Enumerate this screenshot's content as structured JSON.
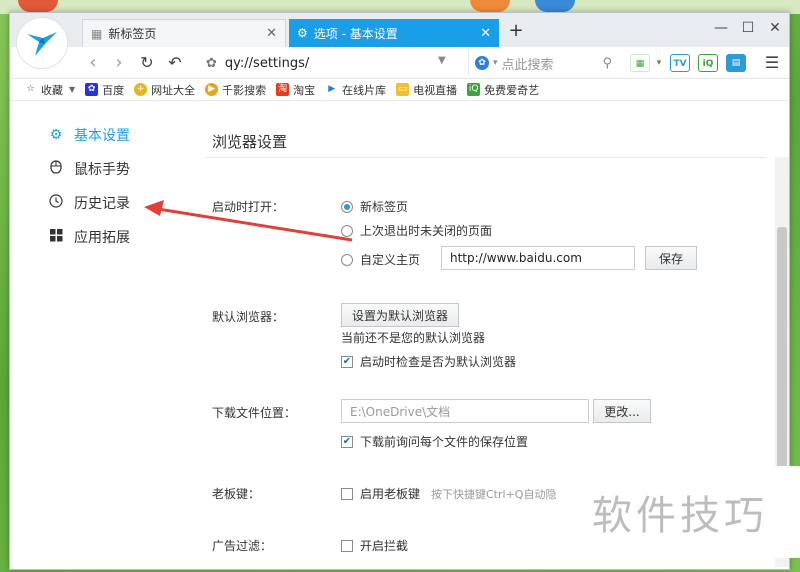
{
  "tabs": [
    {
      "label": "新标签页",
      "close": "✕"
    },
    {
      "label": "选项 - 基本设置",
      "close": "✕"
    }
  ],
  "new_tab_symbol": "+",
  "window_controls": {
    "minimize": "—",
    "maximize": "☐",
    "close": "✕"
  },
  "nav": {
    "back": "‹",
    "forward": "›",
    "refresh": "↻",
    "undo": "↶",
    "address": "qy://settings/",
    "search_placeholder": "点此搜索"
  },
  "bookmarks": [
    {
      "label": "收藏",
      "icon": "star-icon"
    },
    {
      "label": "百度",
      "icon": "baidu-icon"
    },
    {
      "label": "网址大全",
      "icon": "directory-icon"
    },
    {
      "label": "千影搜索",
      "icon": "video-search-icon"
    },
    {
      "label": "淘宝",
      "icon": "taobao-icon"
    },
    {
      "label": "在线片库",
      "icon": "film-library-icon"
    },
    {
      "label": "电视直播",
      "icon": "tv-live-icon"
    },
    {
      "label": "免费爱奇艺",
      "icon": "iqiyi-icon"
    }
  ],
  "sidebar": {
    "items": [
      {
        "label": "基本设置",
        "icon": "gear-icon",
        "active": true
      },
      {
        "label": "鼠标手势",
        "icon": "mouse-icon",
        "active": false
      },
      {
        "label": "历史记录",
        "icon": "clock-icon",
        "active": false
      },
      {
        "label": "应用拓展",
        "icon": "grid-icon",
        "active": false
      }
    ]
  },
  "settings": {
    "title": "浏览器设置",
    "startup": {
      "label": "启动时打开：",
      "option_newtab": "新标签页",
      "option_restore": "上次退出时未关闭的页面",
      "option_homepage": "自定义主页",
      "homepage_value": "http://www.baidu.com",
      "save_label": "保存",
      "selected": "新标签页"
    },
    "default_browser": {
      "label": "默认浏览器：",
      "button": "设置为默认浏览器",
      "status": "当前还不是您的默认浏览器",
      "check_on_start": "启动时检查是否为默认浏览器",
      "check_on_start_checked": true
    },
    "download": {
      "label": "下载文件位置：",
      "path": "E:\\OneDrive\\文档",
      "change_button": "更改...",
      "ask_each": "下载前询问每个文件的保存位置",
      "ask_each_checked": true
    },
    "boss_key": {
      "label": "老板键：",
      "enable": "启用老板键",
      "enable_checked": false,
      "hint": "按下快捷键Ctrl+Q自动隐"
    },
    "ad_filter": {
      "label": "广告过滤：",
      "enable": "开启拦截",
      "enable_checked": false
    }
  },
  "watermark": "软件技巧",
  "colors": {
    "accent": "#1a9ee8",
    "arrow": "#e0403a"
  }
}
